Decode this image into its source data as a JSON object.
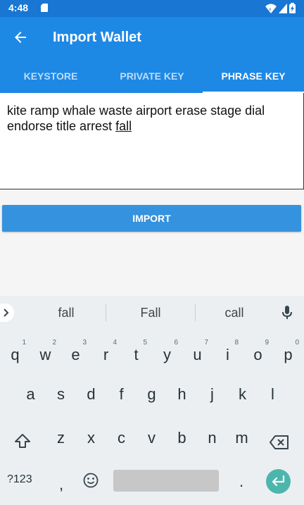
{
  "status": {
    "time": "4:48"
  },
  "appbar": {
    "title": "Import Wallet"
  },
  "tabs": [
    {
      "label": "KEYSTORE"
    },
    {
      "label": "PRIVATE KEY"
    },
    {
      "label": "PHRASE KEY"
    }
  ],
  "phrase": {
    "text_main": "kite ramp whale waste airport erase stage dial endorse title arrest ",
    "text_underlined": "fall"
  },
  "import_button": {
    "label": "IMPORT"
  },
  "keyboard": {
    "suggestions": [
      "fall",
      "Fall",
      "call"
    ],
    "row1": [
      {
        "letter": "q",
        "num": "1"
      },
      {
        "letter": "w",
        "num": "2"
      },
      {
        "letter": "e",
        "num": "3"
      },
      {
        "letter": "r",
        "num": "4"
      },
      {
        "letter": "t",
        "num": "5"
      },
      {
        "letter": "y",
        "num": "6"
      },
      {
        "letter": "u",
        "num": "7"
      },
      {
        "letter": "i",
        "num": "8"
      },
      {
        "letter": "o",
        "num": "9"
      },
      {
        "letter": "p",
        "num": "0"
      }
    ],
    "row2": [
      "a",
      "s",
      "d",
      "f",
      "g",
      "h",
      "j",
      "k",
      "l"
    ],
    "row3": [
      "z",
      "x",
      "c",
      "v",
      "b",
      "n",
      "m"
    ],
    "symbols_label": "?123",
    "comma": ",",
    "period": "."
  },
  "colors": {
    "primary": "#1e88e5",
    "status": "#1976d2",
    "button": "#3592df",
    "enter": "#4db6ac"
  }
}
